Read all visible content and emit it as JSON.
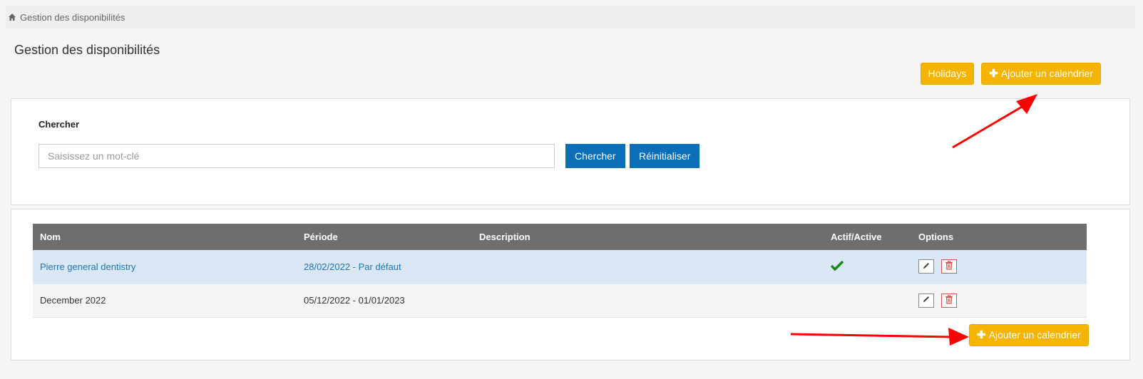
{
  "breadcrumb": {
    "icon": "home-icon",
    "label": "Gestion des disponibilités"
  },
  "page": {
    "title": "Gestion des disponibilités"
  },
  "actions": {
    "holidays_label": "Holidays",
    "add_calendar_label": "Ajouter un calendrier"
  },
  "search": {
    "label": "Chercher",
    "placeholder": "Saisissez un mot-clé",
    "search_button": "Chercher",
    "reset_button": "Réinitialiser"
  },
  "table": {
    "columns": [
      "Nom",
      "Période",
      "Description",
      "Actif/Active",
      "Options"
    ],
    "rows": [
      {
        "nom": "Pierre general dentistry",
        "periode": "28/02/2022 - Par défaut",
        "description": "",
        "active": true
      },
      {
        "nom": "December 2022",
        "periode": "05/12/2022 - 01/01/2023",
        "description": "",
        "active": false
      }
    ]
  },
  "colors": {
    "accent_yellow": "#f5b400",
    "primary_blue": "#0a6fb7",
    "header_gray": "#6e6e6e",
    "row_highlight": "#d9e8f4",
    "check_green": "#1a8a1a",
    "delete_red": "#d9534f",
    "annotation_arrow": "#ff0000"
  }
}
